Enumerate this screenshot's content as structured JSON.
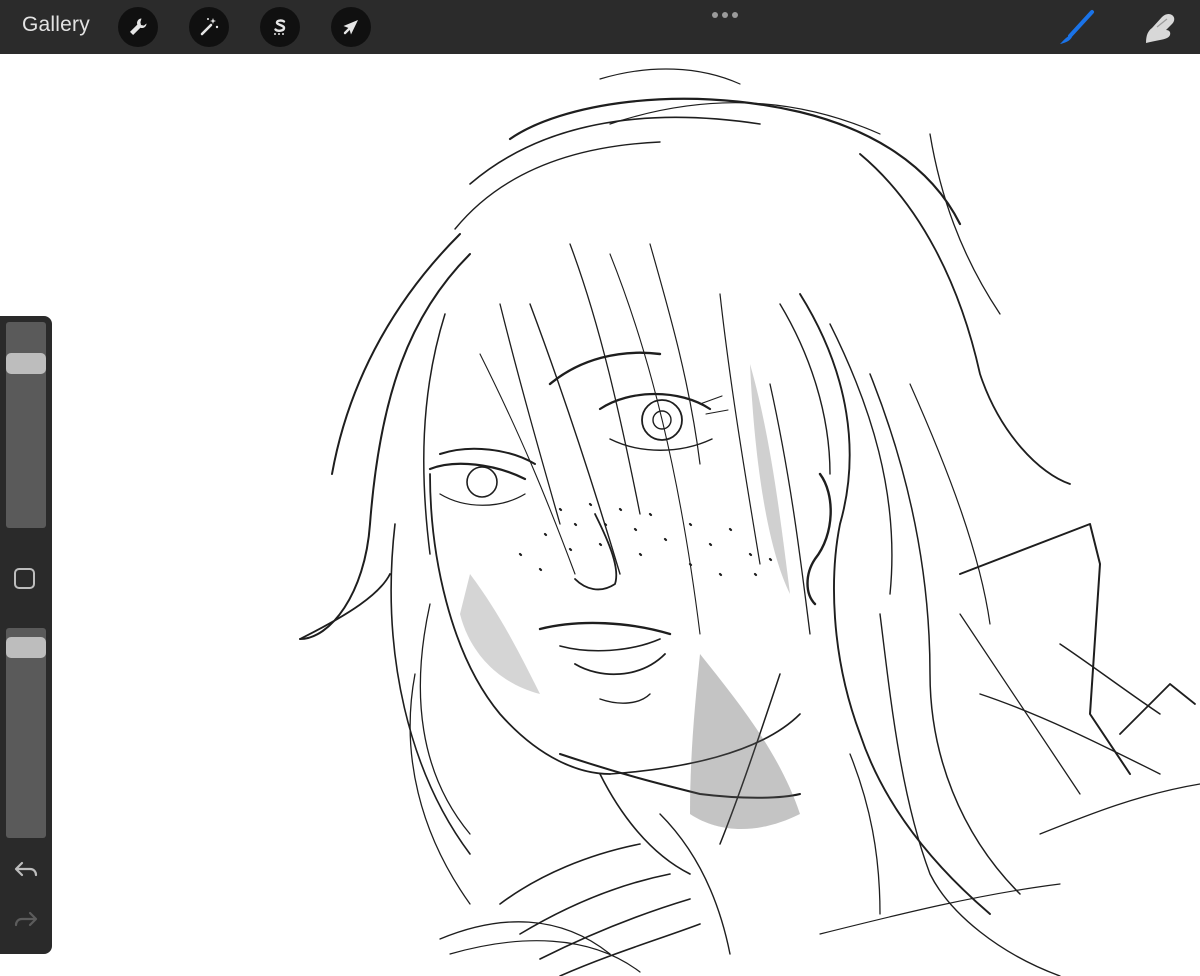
{
  "toolbar": {
    "gallery_label": "Gallery",
    "left_tools": [
      {
        "name": "actions",
        "icon": "wrench-icon"
      },
      {
        "name": "adjustments",
        "icon": "magic-wand-icon"
      },
      {
        "name": "selection",
        "icon": "selection-s-icon"
      },
      {
        "name": "transform",
        "icon": "arrow-cursor-icon"
      }
    ],
    "more_icon": "ellipsis-icon",
    "right_tools": [
      {
        "name": "brush",
        "icon": "brush-icon",
        "active": true
      },
      {
        "name": "smudge",
        "icon": "smudge-finger-icon",
        "active": false
      }
    ]
  },
  "sidebar": {
    "brush_size_level": 0.83,
    "brush_opacity_level": 0.95,
    "modify_button_icon": "square-icon",
    "undo_icon": "undo-icon",
    "redo_icon": "redo-icon"
  },
  "colors": {
    "toolbar_bg": "#2b2b2b",
    "tool_circle_bg": "#101010",
    "active_brush_blue": "#1a73e8",
    "canvas_bg": "#ffffff",
    "sketch_stroke": "#1e1e1e"
  }
}
